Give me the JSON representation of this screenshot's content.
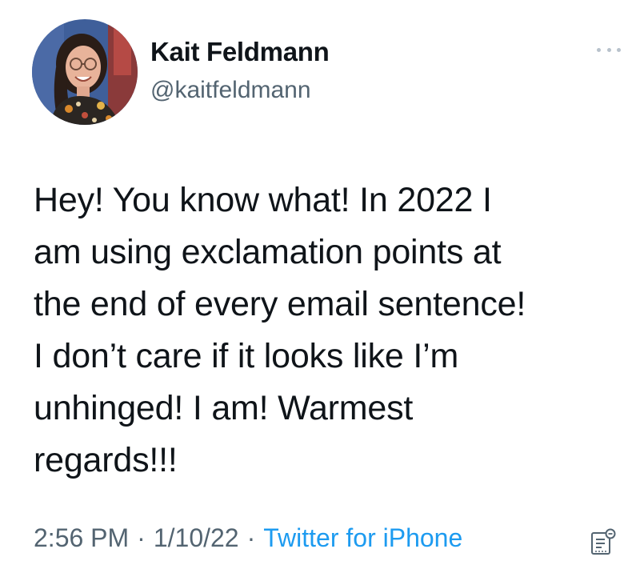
{
  "tweet": {
    "author": {
      "display_name": "Kait Feldmann",
      "handle": "@kaitfeldmann",
      "avatar_icon": "profile-photo"
    },
    "more_icon": "more-options-icon",
    "text": "Hey! You know what! In 2022 I\nam using exclamation points at\nthe end of every email sentence!\nI don’t care if it looks like I’m\nunhinged! I am! Warmest\nregards!!!",
    "time": "2:56 PM",
    "separator": "·",
    "date": "1/10/22",
    "source": "Twitter for iPhone",
    "analytics_icon": "analytics-icon"
  },
  "colors": {
    "text_primary": "#0f1419",
    "text_secondary": "#536471",
    "link": "#1d9bf0",
    "background": "#ffffff"
  }
}
